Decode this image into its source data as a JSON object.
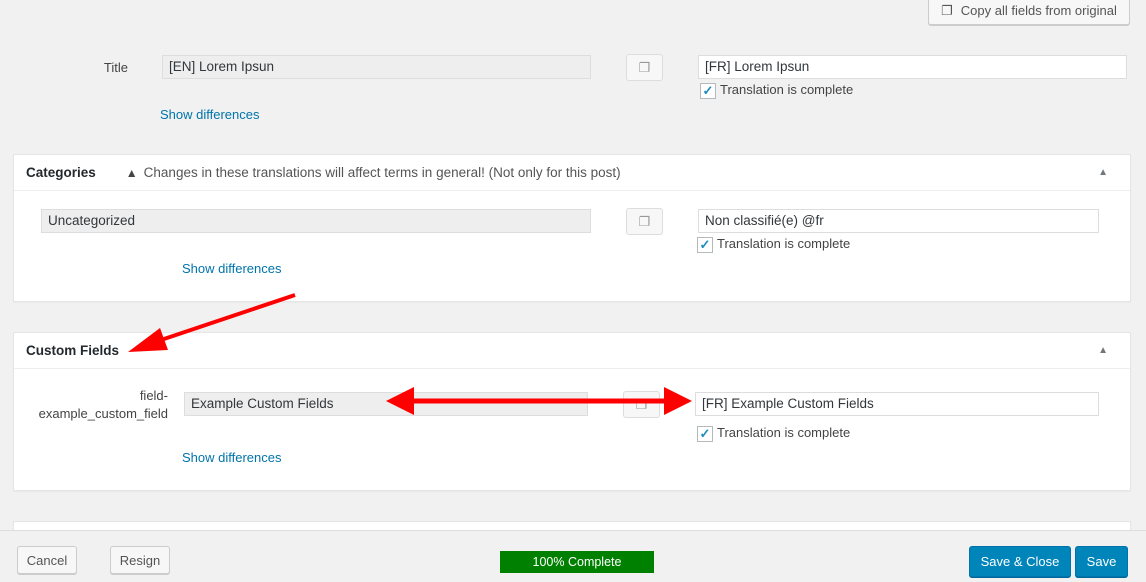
{
  "header": {
    "copy_all_label": "Copy all fields from original"
  },
  "title_field": {
    "label": "Title",
    "original": "[EN] Lorem Ipsun",
    "translation": "[FR] Lorem Ipsun",
    "complete_label": "Translation is complete",
    "complete": true,
    "show_diff": "Show differences"
  },
  "categories": {
    "title": "Categories",
    "warning": "Changes in these translations will affect terms in general! (Not only for this post)",
    "original": "Uncategorized",
    "translation": "Non classifié(e) @fr",
    "complete_label": "Translation is complete",
    "complete": true,
    "show_diff": "Show differences"
  },
  "custom_fields": {
    "title": "Custom Fields",
    "label_line1": "field-",
    "label_line2": "example_custom_field",
    "original": "Example Custom Fields",
    "translation": "[FR] Example Custom Fields",
    "complete_label": "Translation is complete",
    "complete": true,
    "show_diff": "Show differences"
  },
  "footer": {
    "cancel": "Cancel",
    "resign": "Resign",
    "progress_label": "100% Complete",
    "progress_percent": 100,
    "save_close": "Save & Close",
    "save": "Save"
  },
  "colors": {
    "accent": "#0085ba",
    "progress": "#008000",
    "annotation": "#ff0000"
  }
}
